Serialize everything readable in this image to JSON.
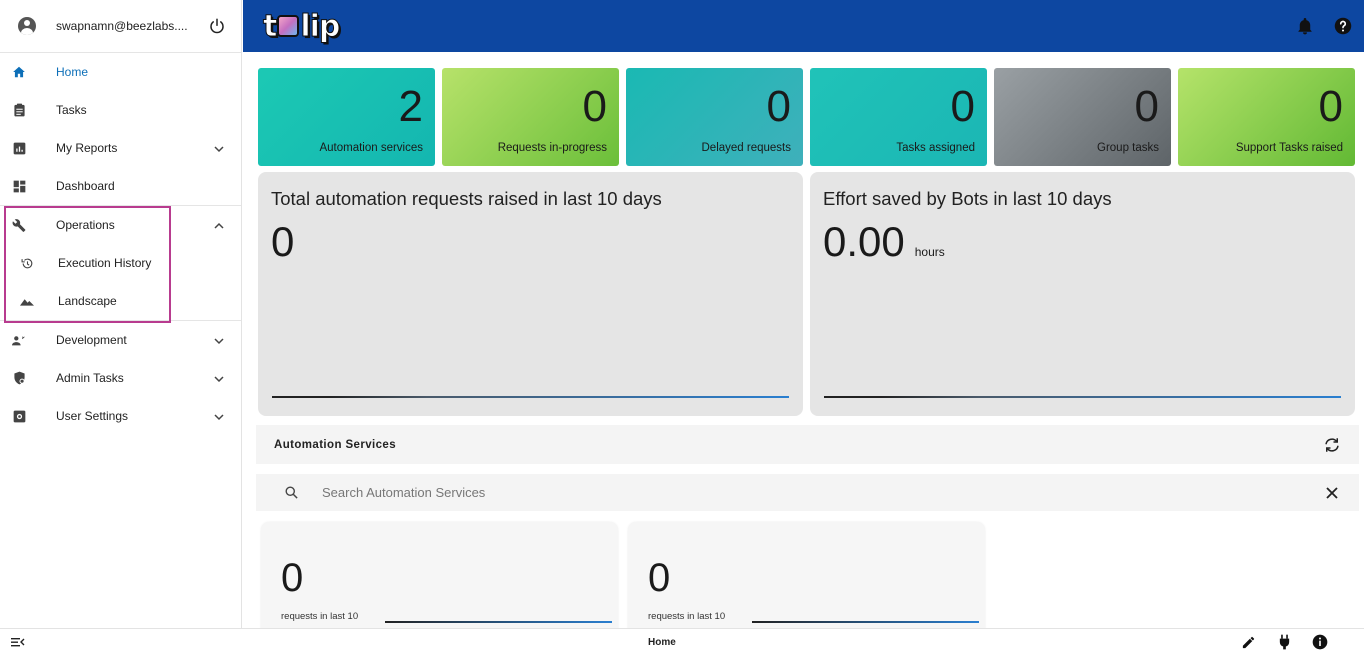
{
  "user": {
    "email": "swapnamn@beezlabs...."
  },
  "header": {
    "logo_text_start": "t",
    "logo_text_end": "lip"
  },
  "nav": {
    "home": "Home",
    "tasks": "Tasks",
    "my_reports": "My Reports",
    "dashboard": "Dashboard",
    "operations": "Operations",
    "execution_history": "Execution History",
    "landscape": "Landscape",
    "development": "Development",
    "admin_tasks": "Admin Tasks",
    "user_settings": "User Settings"
  },
  "tiles": [
    {
      "value": "2",
      "label": "Automation services"
    },
    {
      "value": "0",
      "label": "Requests in-progress"
    },
    {
      "value": "0",
      "label": "Delayed requests"
    },
    {
      "value": "0",
      "label": "Tasks assigned"
    },
    {
      "value": "0",
      "label": "Group tasks"
    },
    {
      "value": "0",
      "label": "Support Tasks raised"
    }
  ],
  "panels": {
    "requests": {
      "title": "Total automation requests raised in last 10 days",
      "value": "0"
    },
    "effort": {
      "title": "Effort saved by Bots in last 10 days",
      "value": "0.00",
      "unit": "hours"
    }
  },
  "services": {
    "title": "Automation Services",
    "search_placeholder": "Search Automation Services"
  },
  "cards": [
    {
      "value": "0",
      "label": "requests in last 10"
    },
    {
      "value": "0",
      "label": "requests in last 10"
    }
  ],
  "footer": {
    "page": "Home"
  },
  "colors": {
    "header": "#0d47a1",
    "active": "#0d6fb8",
    "highlight": "#b83b8f"
  }
}
